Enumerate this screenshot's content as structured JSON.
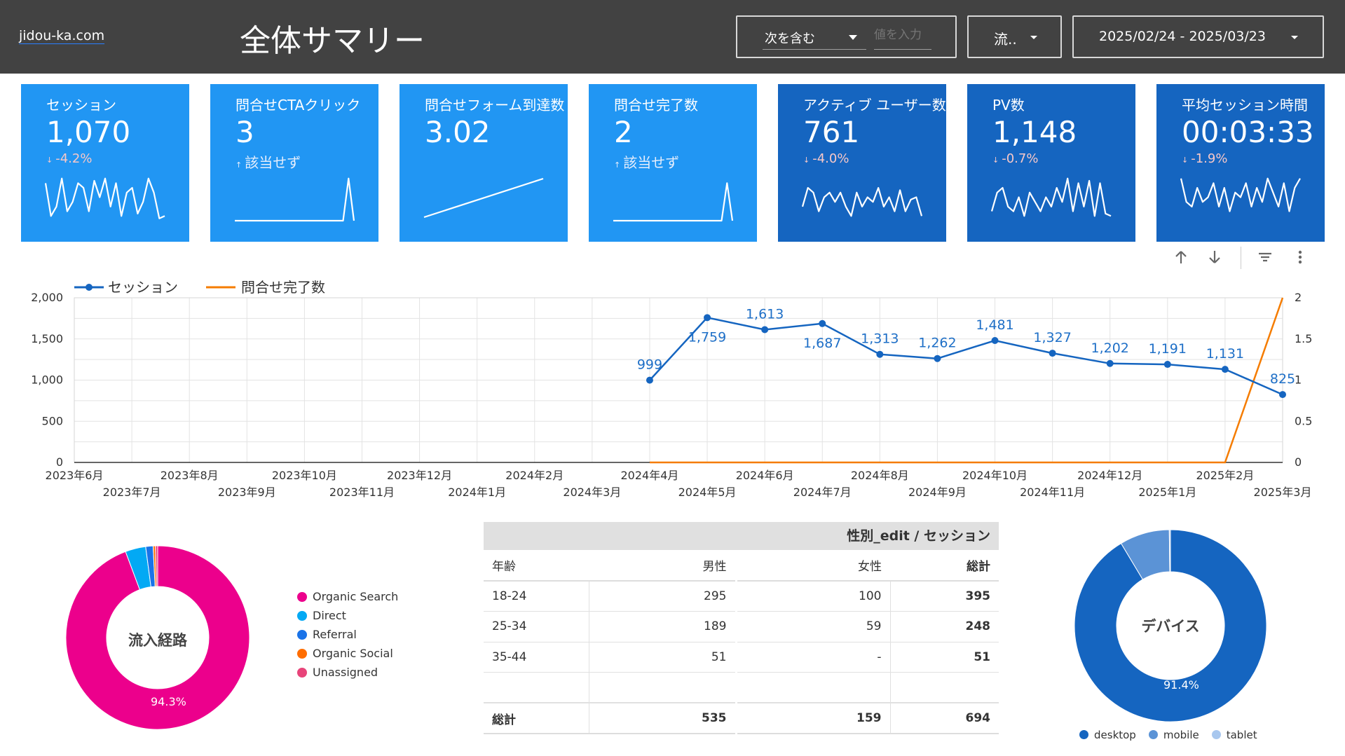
{
  "header": {
    "site": "jidou-ka.com",
    "title": "全体サマリー",
    "filter_condition": "次を含む",
    "filter_placeholder": "値を入力",
    "channel_filter": "流..",
    "date_range": "2025/02/24 - 2025/03/23"
  },
  "colors": {
    "header_bg": "#424242",
    "card_light": "#2196f3",
    "card_dark": "#1565c0",
    "series_sessions": "#1565c0",
    "series_conversions": "#f57c00"
  },
  "scorecards": [
    {
      "label": "セッション",
      "value": "1,070",
      "delta": "-4.2%",
      "delta_dir": "down",
      "style": "light"
    },
    {
      "label": "問合せCTAクリック",
      "value": "3",
      "delta": "該当せず",
      "delta_dir": "up",
      "style": "light"
    },
    {
      "label": "問合せフォーム到達数",
      "value": "3.02",
      "delta": "",
      "delta_dir": "none",
      "style": "light"
    },
    {
      "label": "問合せ完了数",
      "value": "2",
      "delta": "該当せず",
      "delta_dir": "up",
      "style": "light"
    },
    {
      "label": "アクティブ ユーザー数",
      "value": "761",
      "delta": "-4.0%",
      "delta_dir": "down",
      "style": "dark"
    },
    {
      "label": "PV数",
      "value": "1,148",
      "delta": "-0.7%",
      "delta_dir": "down",
      "style": "dark"
    },
    {
      "label": "平均セッション時間",
      "value": "00:03:33",
      "delta": "-1.9%",
      "delta_dir": "down",
      "style": "dark"
    }
  ],
  "toolbar": {
    "icons": [
      "arrow-up-icon",
      "arrow-down-icon",
      "filter-icon",
      "more-vert-icon"
    ]
  },
  "chart_data": [
    {
      "type": "line",
      "legend_position": "top-left",
      "x": [
        "2023年6月",
        "2023年7月",
        "2023年8月",
        "2023年9月",
        "2023年10月",
        "2023年11月",
        "2023年12月",
        "2024年1月",
        "2024年2月",
        "2024年3月",
        "2024年4月",
        "2024年5月",
        "2024年6月",
        "2024年7月",
        "2024年8月",
        "2024年9月",
        "2024年10月",
        "2024年11月",
        "2024年12月",
        "2025年1月",
        "2025年2月",
        "2025年3月"
      ],
      "series": [
        {
          "name": "セッション",
          "axis": "left",
          "values": [
            null,
            null,
            null,
            null,
            null,
            null,
            null,
            null,
            null,
            null,
            999,
            1759,
            1613,
            1687,
            1313,
            1262,
            1481,
            1327,
            1202,
            1191,
            1131,
            825
          ]
        },
        {
          "name": "問合せ完了数",
          "axis": "right",
          "values": [
            null,
            null,
            null,
            null,
            null,
            null,
            null,
            null,
            null,
            null,
            0,
            0,
            0,
            0,
            0,
            0,
            0,
            0,
            0,
            0,
            0,
            2
          ]
        }
      ],
      "y_left_ticks": [
        "0",
        "500",
        "1,000",
        "1,500",
        "2,000"
      ],
      "y_right_ticks": [
        "0",
        "0.5",
        "1",
        "1.5",
        "2"
      ],
      "ylim_left": [
        0,
        2000
      ],
      "ylim_right": [
        0,
        2
      ],
      "grid": true
    },
    {
      "type": "pie",
      "center_label": "流入経路",
      "categories": [
        "Organic Search",
        "Direct",
        "Referral",
        "Organic Social",
        "Unassigned"
      ],
      "values": [
        94.3,
        3.6,
        1.3,
        0.4,
        0.4
      ],
      "colors": [
        "#ec008c",
        "#03a9f4",
        "#1a73e8",
        "#ff6d00",
        "#e8447a"
      ],
      "label": "94.3%",
      "legend_position": "right"
    },
    {
      "type": "pie",
      "center_label": "デバイス",
      "categories": [
        "desktop",
        "mobile",
        "tablet"
      ],
      "values": [
        91.4,
        8.4,
        0.2
      ],
      "colors": [
        "#1565c0",
        "#5b93d6",
        "#a8c7ee"
      ],
      "label": "91.4%",
      "legend_position": "bottom"
    },
    {
      "type": "table",
      "title": "性別_edit / セッション",
      "columns": [
        "年齢",
        "男性",
        "女性",
        "総計"
      ],
      "rows": [
        [
          "18-24",
          "295",
          "100",
          "395"
        ],
        [
          "25-34",
          "189",
          "59",
          "248"
        ],
        [
          "35-44",
          "51",
          "-",
          "51"
        ],
        [
          "",
          "",
          "",
          ""
        ]
      ],
      "total": [
        "総計",
        "535",
        "159",
        "694"
      ]
    }
  ]
}
